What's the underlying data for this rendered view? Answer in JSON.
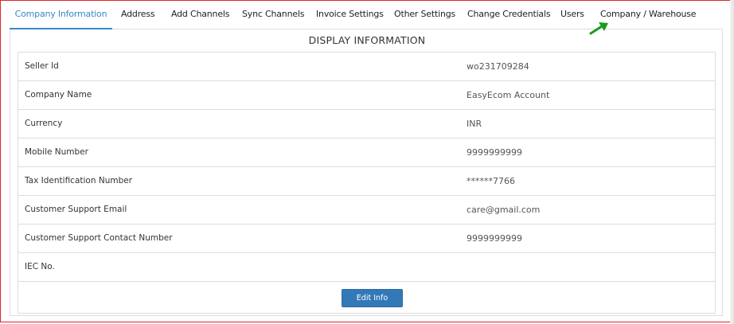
{
  "tabs": [
    {
      "label": "Company Information",
      "active": true
    },
    {
      "label": "Address"
    },
    {
      "label": "Add Channels"
    },
    {
      "label": "Sync Channels"
    },
    {
      "label": "Invoice Settings"
    },
    {
      "label": "Other Settings"
    },
    {
      "label": "Change Credentials"
    },
    {
      "label": "Users"
    },
    {
      "label": "Company / Warehouse"
    }
  ],
  "annotation": {
    "icon": "green-arrow-icon",
    "color": "#1a9a1a"
  },
  "section": {
    "title": "DISPLAY INFORMATION"
  },
  "fields": [
    {
      "label": "Seller Id",
      "value": "wo231709284"
    },
    {
      "label": "Company Name",
      "value": "EasyEcom Account"
    },
    {
      "label": "Currency",
      "value": "INR"
    },
    {
      "label": "Mobile Number",
      "value": "9999999999"
    },
    {
      "label": "Tax Identification Number",
      "value": "******7766"
    },
    {
      "label": "Customer Support Email",
      "value": "care@gmail.com"
    },
    {
      "label": "Customer Support Contact Number",
      "value": "9999999999"
    },
    {
      "label": "IEC No.",
      "value": ""
    }
  ],
  "actions": {
    "edit_label": "Edit Info"
  },
  "colors": {
    "accent": "#3a87c9",
    "button": "#3379b7",
    "frame": "#d9262b"
  }
}
